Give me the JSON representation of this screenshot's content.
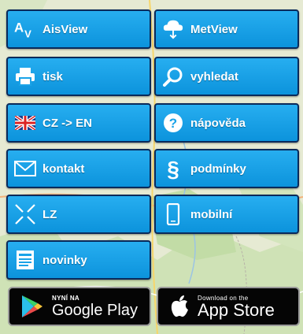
{
  "buttons": {
    "aisview": "AisView",
    "metview": "MetView",
    "tisk": "tisk",
    "vyhledat": "vyhledat",
    "lang": "CZ -> EN",
    "napoveda": "nápověda",
    "kontakt": "kontakt",
    "podminky": "podmínky",
    "lz": "LZ",
    "mobilni": "mobilní",
    "novinky": "novinky"
  },
  "stores": {
    "google_small": "NYNÍ NA",
    "google_big": "Google Play",
    "apple_small": "Download on the",
    "apple_big": "App Store"
  },
  "colors": {
    "button": "#1aa3e8",
    "button_border": "#0a2a5a",
    "store_bg": "#050505"
  }
}
